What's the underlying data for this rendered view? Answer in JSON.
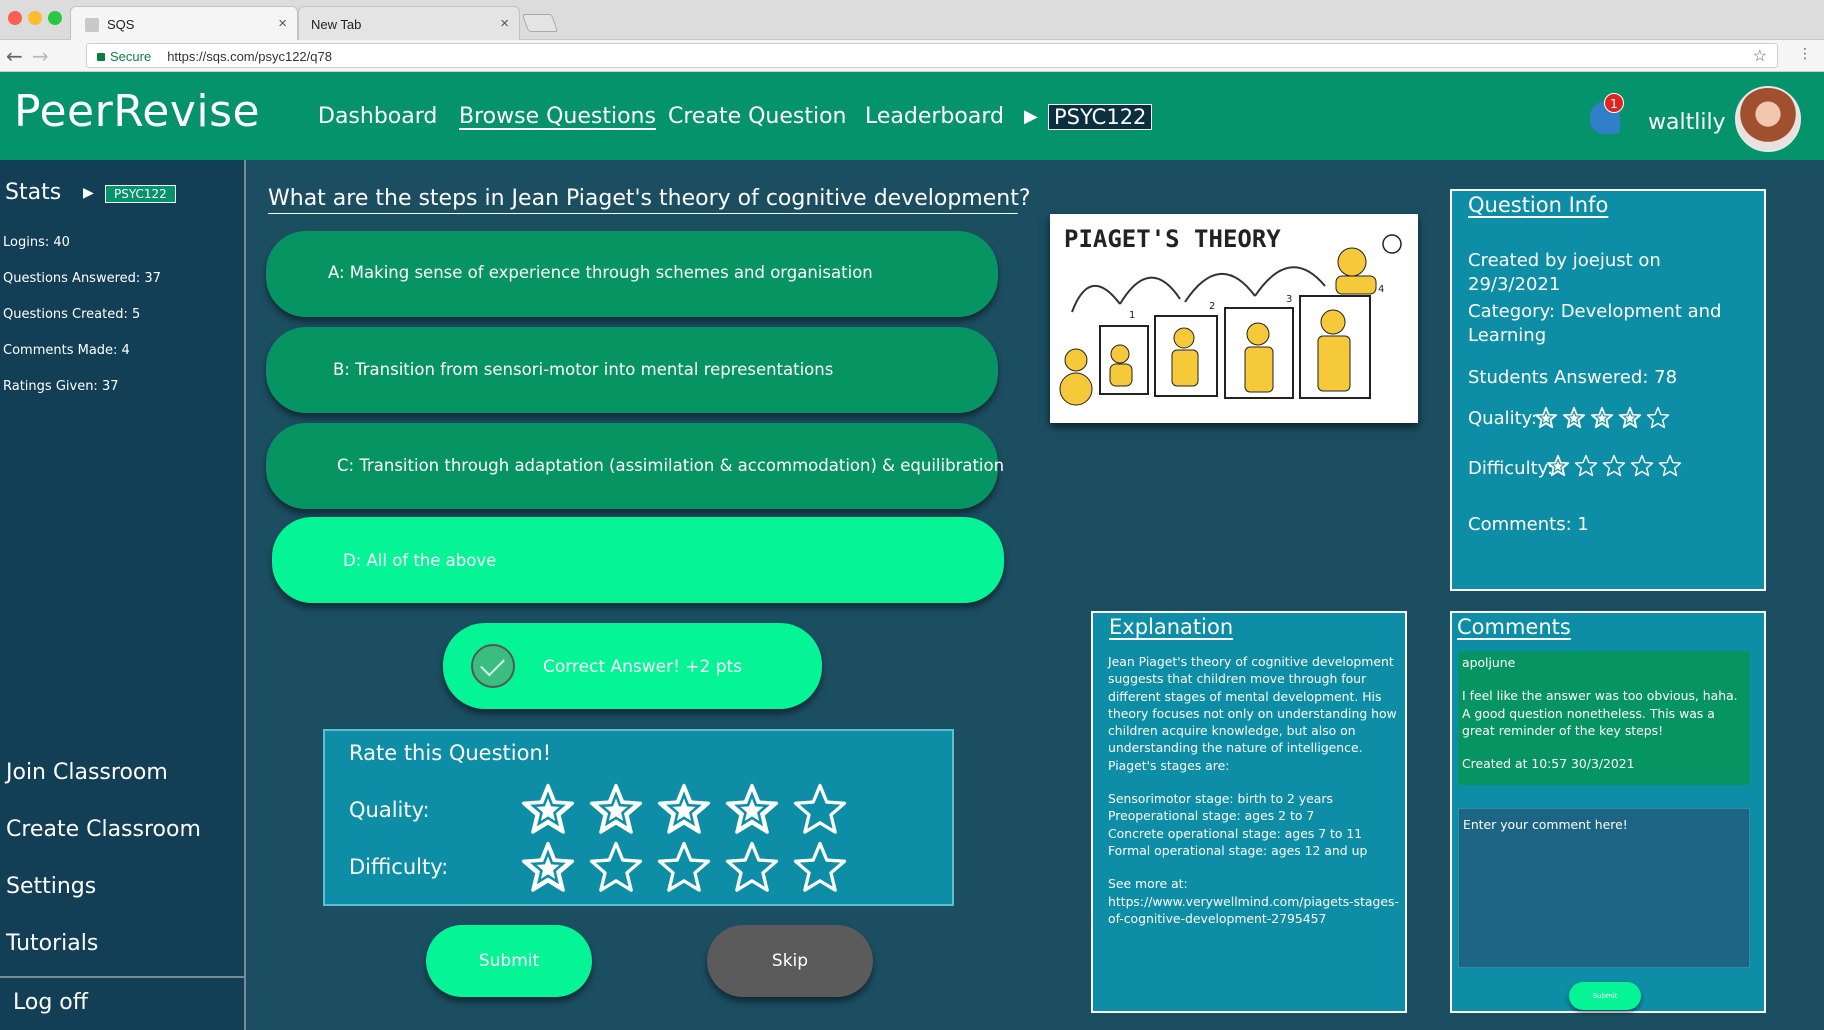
{
  "browser": {
    "tabs": [
      {
        "title": "SQS",
        "active": true
      },
      {
        "title": "New Tab",
        "active": false
      }
    ],
    "security_label": "Secure",
    "url": "https://sqs.com/psyc122/q78"
  },
  "header": {
    "logo": "PeerRevise",
    "nav": [
      "Dashboard",
      "Browse Questions",
      "Create Question",
      "Leaderboard"
    ],
    "active_nav": "Browse Questions",
    "course": "PSYC122",
    "notification_count": "1",
    "username": "waltlily"
  },
  "sidebar": {
    "stats_title": "Stats",
    "course": "PSYC122",
    "stats": [
      "Logins: 40",
      "Questions Answered: 37",
      "Questions Created: 5",
      "Comments Made: 4",
      "Ratings Given: 37"
    ],
    "links": [
      "Join Classroom",
      "Create Classroom",
      "Settings",
      "Tutorials"
    ],
    "logoff": "Log off"
  },
  "question": {
    "text": "What are the steps in Jean Piaget's theory of cognitive development?",
    "options": [
      "A: Making sense of experience through schemes and organisation",
      "B: Transition from sensori-motor into mental representations",
      "C: Transition through adaptation (assimilation & accommodation) & equilibration",
      "D: All of the above"
    ],
    "selected_option": 3,
    "result": "Correct Answer!    +2 pts"
  },
  "rating": {
    "title": "Rate this Question!",
    "quality_label": "Quality:",
    "difficulty_label": "Difficulty:",
    "quality_value": 4,
    "difficulty_value": 1,
    "max_stars": 5,
    "submit_label": "Submit",
    "skip_label": "Skip"
  },
  "image": {
    "title": "PIAGET'S THEORY",
    "stage_numbers": [
      "1",
      "2",
      "3",
      "4"
    ]
  },
  "info": {
    "title": "Question Info",
    "created": "Created by joejust on 29/3/2021",
    "category": "Category: Development and Learning",
    "students_answered": "Students Answered: 78",
    "quality_label": "Quality:",
    "quality_value": 4,
    "difficulty_label": "Difficulty:",
    "difficulty_value": 1,
    "comments": "Comments: 1"
  },
  "explanation": {
    "title": "Explanation",
    "paragraph": "Jean Piaget's theory of cognitive development suggests that children move through four different stages of mental development. His theory focuses not only on understanding how children acquire knowledge, but also on understanding the nature of intelligence. Piaget's stages are:",
    "stages": [
      "Sensorimotor stage: birth to 2 years",
      "Preoperational stage: ages 2 to 7",
      "Concrete operational stage: ages 7 to 11",
      "Formal operational stage: ages 12 and up"
    ],
    "see_more": "See more at:",
    "link": "https://www.verywellmind.com/piagets-stages-of-cognitive-development-2795457"
  },
  "comments": {
    "title": "Comments",
    "items": [
      {
        "author": "apoljune",
        "text": "I feel like the answer was too obvious, haha. A good question nonetheless. This was a great reminder of the key steps!",
        "created": "Created at 10:57 30/3/2021"
      }
    ],
    "input_placeholder": "Enter your comment here!",
    "submit_label": "Submit"
  },
  "colors": {
    "brand_green": "#04936a",
    "option_green": "#079463",
    "bright_green": "#05f596",
    "panel_teal": "#0e8ea6",
    "background": "#1c4e62",
    "sidebar": "#133f56"
  }
}
